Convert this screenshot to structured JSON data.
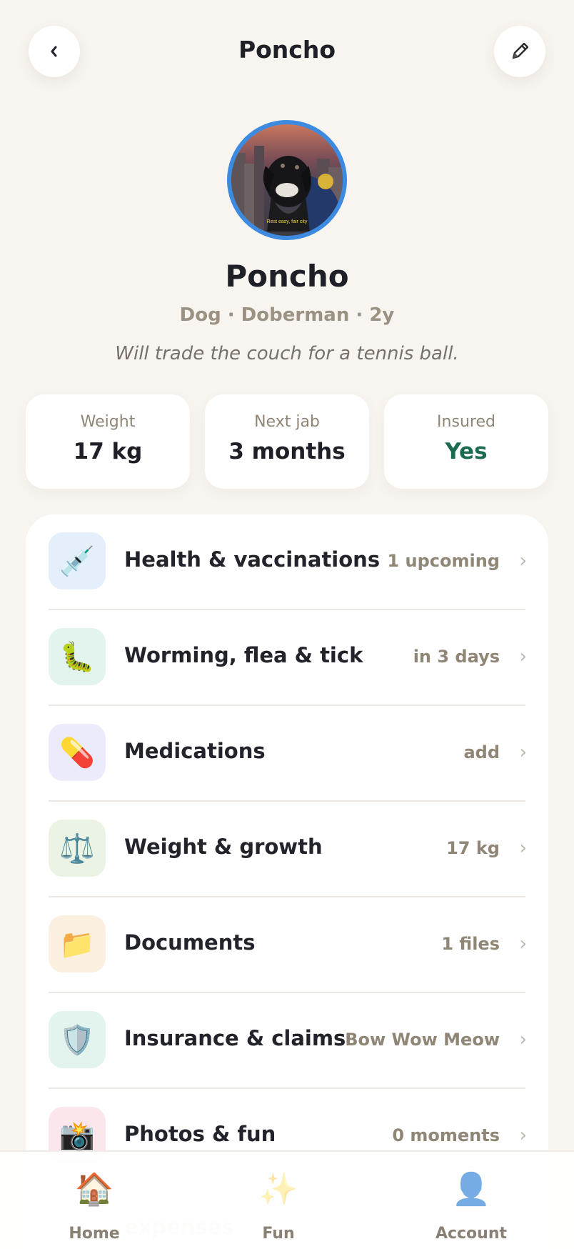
{
  "header": {
    "title": "Poncho",
    "back_icon": "chevron-left-icon",
    "edit_icon": "pencil-icon"
  },
  "profile": {
    "name": "Poncho",
    "subtitle": "Dog · Doberman · 2y",
    "bio": "Will trade the couch for a tennis ball.",
    "avatar_caption": "Rest easy, fair city"
  },
  "stats": [
    {
      "label": "Weight",
      "value": "17 kg"
    },
    {
      "label": "Next jab",
      "value": "3 months"
    },
    {
      "label": "Insured",
      "value": "Yes"
    }
  ],
  "menu": [
    {
      "label": "Health & vaccinations",
      "value": "1 upcoming",
      "icon": "syringe-icon",
      "glyph": "💉",
      "bg": "#e4effb"
    },
    {
      "label": "Worming, flea & tick",
      "value": "in 3 days",
      "icon": "bug-icon",
      "glyph": "🐛",
      "bg": "#e3f4ee"
    },
    {
      "label": "Medications",
      "value": "add",
      "icon": "pill-icon",
      "glyph": "💊",
      "bg": "#ecebfb"
    },
    {
      "label": "Weight & growth",
      "value": "17 kg",
      "icon": "scales-icon",
      "glyph": "⚖️",
      "bg": "#eaf3e4"
    },
    {
      "label": "Documents",
      "value": "1 files",
      "icon": "folder-icon",
      "glyph": "📁",
      "bg": "#fbefe0"
    },
    {
      "label": "Insurance & claims",
      "value": "Bow Wow Meow",
      "icon": "shield-icon",
      "glyph": "🛡️",
      "bg": "#e3f4ee"
    },
    {
      "label": "Photos & fun",
      "value": "0 moments",
      "icon": "camera-icon",
      "glyph": "📸",
      "bg": "#fbe6ec"
    }
  ],
  "ghost_label": "expenses",
  "tabs": [
    {
      "label": "Home",
      "icon": "house-icon",
      "glyph": "🏠"
    },
    {
      "label": "Fun",
      "icon": "sparkles-icon",
      "glyph": "✨"
    },
    {
      "label": "Account",
      "icon": "person-icon",
      "glyph": "👤"
    }
  ],
  "colors": {
    "background": "#f8f4ef",
    "avatar_ring": "#3d8be0",
    "insured_yes": "#1c6b4f",
    "muted_text": "#8f8676"
  }
}
